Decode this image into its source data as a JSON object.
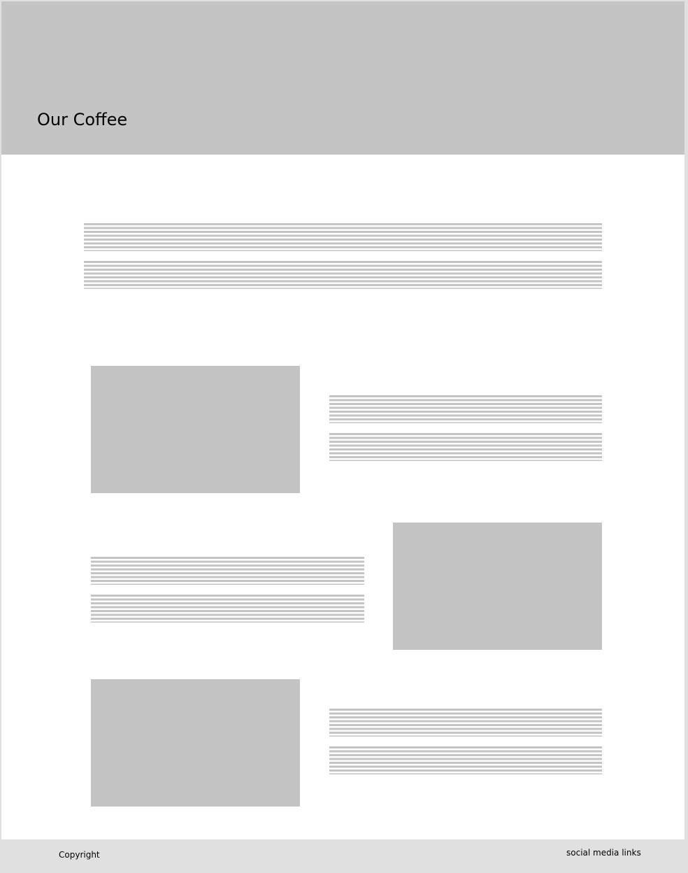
{
  "hero": {
    "title": "Our Coffee"
  },
  "footer": {
    "copyright": "Copyright",
    "social": "social media links"
  },
  "colors": {
    "placeholder": "#c4c4c4",
    "frame": "#e0e0e0",
    "background": "#ffffff"
  }
}
